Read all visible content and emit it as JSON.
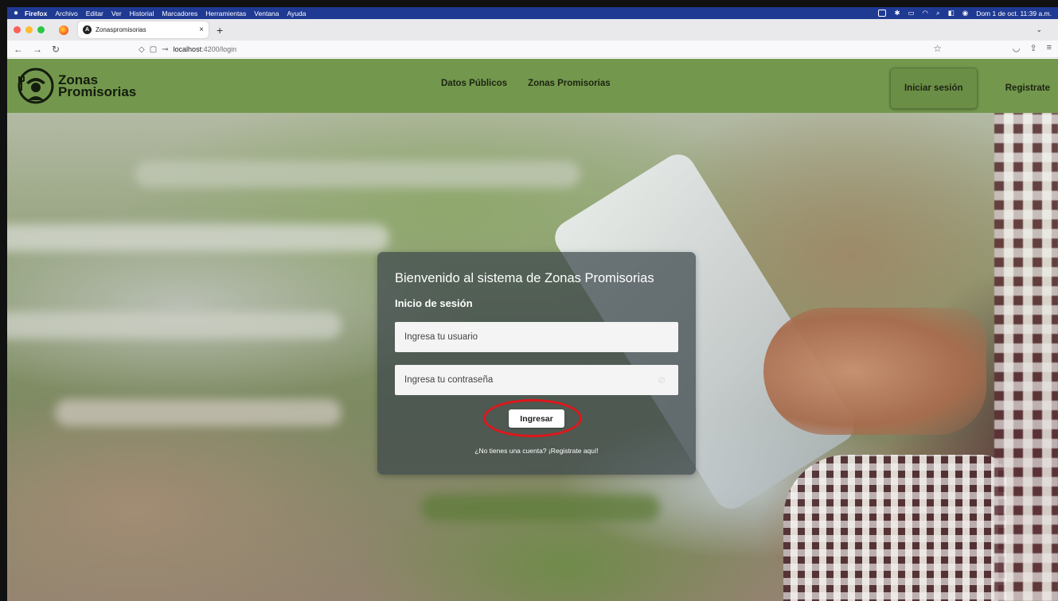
{
  "menubar": {
    "apple_icon": "apple-icon",
    "app": "Firefox",
    "items": [
      "Archivo",
      "Editar",
      "Ver",
      "Historial",
      "Marcadores",
      "Herramientas",
      "Ventana",
      "Ayuda"
    ],
    "datetime": "Dom 1 de oct.  11:39 a.m."
  },
  "tab": {
    "title": "Zonaspromisorias",
    "close": "×",
    "new_tab": "+",
    "list_all": "⌄"
  },
  "navbar": {
    "back": "←",
    "forward": "→",
    "reload": "↻",
    "url_host": "localhost",
    "url_path": ":4200/login"
  },
  "app": {
    "brand_line1": "Zonas",
    "brand_line2": "Promisorias",
    "nav_links": [
      "Datos Públicos",
      "Zonas Promisorias"
    ],
    "login_button": "Iniciar sesión",
    "register_link": "Registrate"
  },
  "login": {
    "title": "Bienvenido al sistema de Zonas Promisorias",
    "subtitle": "Inicio de sesión",
    "username_placeholder": "Ingresa tu usuario",
    "password_placeholder": "Ingresa tu contraseña",
    "submit": "Ingresar",
    "register_prompt": "¿No tienes una cuenta? ¡Registrate aquí!"
  },
  "colors": {
    "header_green": "#73984d",
    "highlight_red": "#e0161a",
    "menubar_blue": "#1f3a93"
  }
}
